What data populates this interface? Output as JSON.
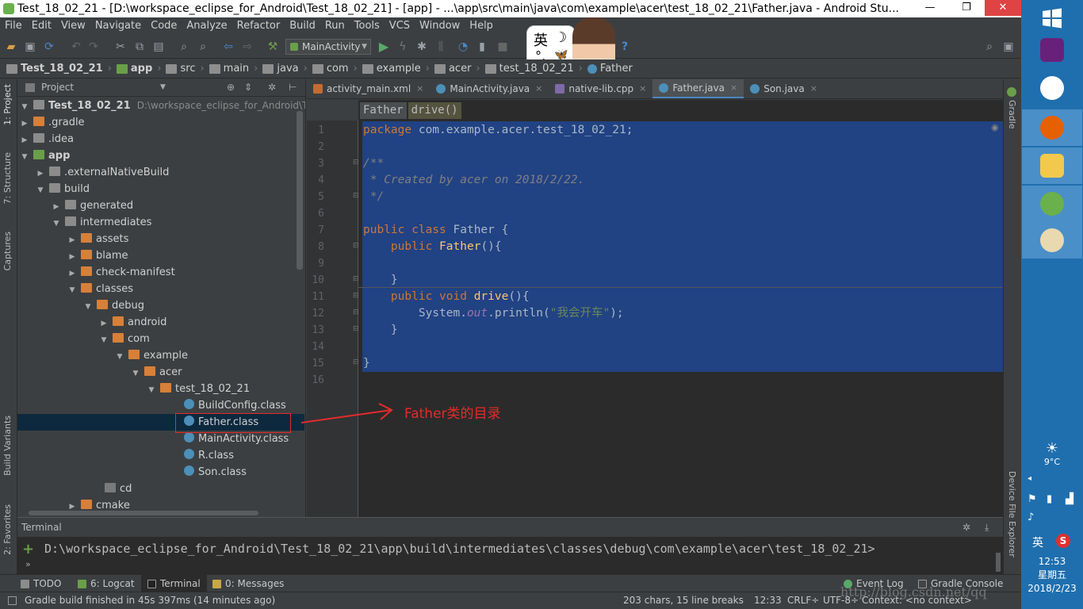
{
  "window": {
    "title": "Test_18_02_21 - [D:\\workspace_eclipse_for_Android\\Test_18_02_21] - [app] - ...\\app\\src\\main\\java\\com\\example\\acer\\test_18_02_21\\Father.java - Android Stu...",
    "minimize": "—",
    "maximize": "❐",
    "close": "✕"
  },
  "menu": [
    "File",
    "Edit",
    "View",
    "Navigate",
    "Code",
    "Analyze",
    "Refactor",
    "Build",
    "Run",
    "Tools",
    "VCS",
    "Window",
    "Help"
  ],
  "toolbar": {
    "run_config": "MainActivity",
    "help": "?"
  },
  "navbar": {
    "crumbs": [
      "Test_18_02_21",
      "app",
      "src",
      "main",
      "java",
      "com",
      "example",
      "acer",
      "test_18_02_21",
      "Father"
    ]
  },
  "ime": {
    "label": "英",
    "moon": "☽",
    "dots": "°,",
    "butterfly": "🦋"
  },
  "left_strip": {
    "project_tab": "1: Project",
    "structure_tab": "7: Structure",
    "captures_tab": "Captures",
    "build_variants_tab": "Build Variants",
    "favorites_tab": "2: Favorites"
  },
  "project_panel": {
    "header": "Project",
    "root_name": "Test_18_02_21",
    "root_path": "D:\\workspace_eclipse_for_Android\\Test_18",
    "tree": [
      {
        "label": ".gradle"
      },
      {
        "label": ".idea"
      },
      {
        "label": "app"
      },
      {
        "label": ".externalNativeBuild"
      },
      {
        "label": "build"
      },
      {
        "label": "generated"
      },
      {
        "label": "intermediates"
      },
      {
        "label": "assets"
      },
      {
        "label": "blame"
      },
      {
        "label": "check-manifest"
      },
      {
        "label": "classes"
      },
      {
        "label": "debug"
      },
      {
        "label": "android"
      },
      {
        "label": "com"
      },
      {
        "label": "example"
      },
      {
        "label": "acer"
      },
      {
        "label": "test_18_02_21"
      },
      {
        "label": "BuildConfig.class"
      },
      {
        "label": "Father.class"
      },
      {
        "label": "MainActivity.class"
      },
      {
        "label": "R.class"
      },
      {
        "label": "Son.class"
      },
      {
        "label": "cd"
      },
      {
        "label": "cmake"
      }
    ]
  },
  "editor_tabs": [
    "activity_main.xml",
    "MainActivity.java",
    "native-lib.cpp",
    "Father.java",
    "Son.java"
  ],
  "tab_close": "×",
  "breadcrumb": {
    "class": "Father",
    "method": "drive()"
  },
  "code": {
    "line_numbers": [
      "1",
      "2",
      "3",
      "4",
      "5",
      "6",
      "7",
      "8",
      "9",
      "10",
      "11",
      "12",
      "13",
      "14",
      "15",
      "16"
    ],
    "package_kw": "package",
    "package_name": " com.example.acer.test_18_02_21;",
    "javadoc_open": "/**",
    "javadoc_body": " * Created by acer on 2018/2/22.",
    "javadoc_close": " */",
    "public_kw": "public",
    "class_kw": " class ",
    "class_name": "Father {",
    "ctor_indent": "    ",
    "ctor_name": "Father",
    "ctor_rest": "(){",
    "close_inner": "    }",
    "void_kw": " void ",
    "method_name": "drive",
    "method_rest": "(){",
    "println_prefix": "        System.",
    "out_field": "out",
    "println_call": ".println(",
    "string_lit": "\"我会开车\"",
    "println_end": ");",
    "close_method": "    }",
    "close_class": "}"
  },
  "annotation": {
    "text": "Father类的目录",
    "color": "#e52b2b"
  },
  "right_strip": {
    "gradle": "Gradle",
    "device_explorer": "Device File Explorer"
  },
  "terminal": {
    "header": "Terminal",
    "prompt": "D:\\workspace_eclipse_for_Android\\Test_18_02_21\\app\\build\\intermediates\\classes\\debug\\com\\example\\acer\\test_18_02_21>",
    "plus": "+",
    "more": "»"
  },
  "bottom_tabs": {
    "todo": "TODO",
    "logcat": "6: Logcat",
    "terminal": "Terminal",
    "messages": "0: Messages",
    "event_log": "Event Log",
    "gradle_console": "Gradle Console"
  },
  "status": {
    "message": "Gradle build finished in 45s 397ms (14 minutes ago)",
    "chars": "203 chars, 15 line breaks",
    "position": "12:33",
    "line_sep": "CRLF÷",
    "encoding": "UTF-8÷",
    "context": "Context: <no context>"
  },
  "watermark": "http://blog.csdn.net/qq",
  "taskbar": {
    "weather_temp": "9°C",
    "time": "12:53",
    "weekday": "星期五",
    "date": "2018/2/23",
    "ime_label": "英",
    "sogou": "S"
  },
  "colors": {
    "selection": "#214283",
    "keyword": "#cc7832",
    "string": "#6a8759",
    "comment": "#808080",
    "function": "#ffc66d",
    "taskbar": "#1f6fae"
  }
}
